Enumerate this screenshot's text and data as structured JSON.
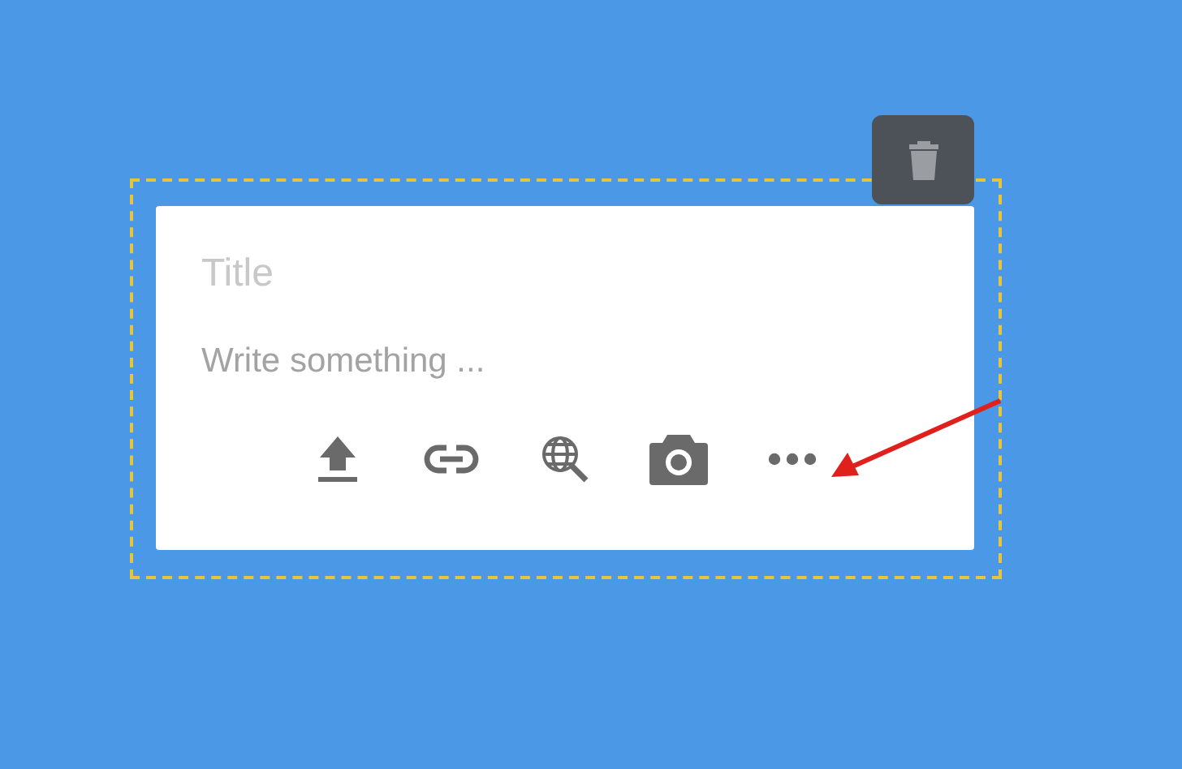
{
  "note_editor": {
    "title_field": {
      "placeholder": "Title"
    },
    "body_field": {
      "placeholder": "Write something ..."
    },
    "delete_button": {
      "kind": "trash"
    },
    "toolbar": [
      {
        "kind": "upload"
      },
      {
        "kind": "link"
      },
      {
        "kind": "web-search"
      },
      {
        "kind": "camera"
      },
      {
        "kind": "more"
      }
    ]
  },
  "annotation": {
    "kind": "arrow",
    "color": "#e0201c"
  }
}
